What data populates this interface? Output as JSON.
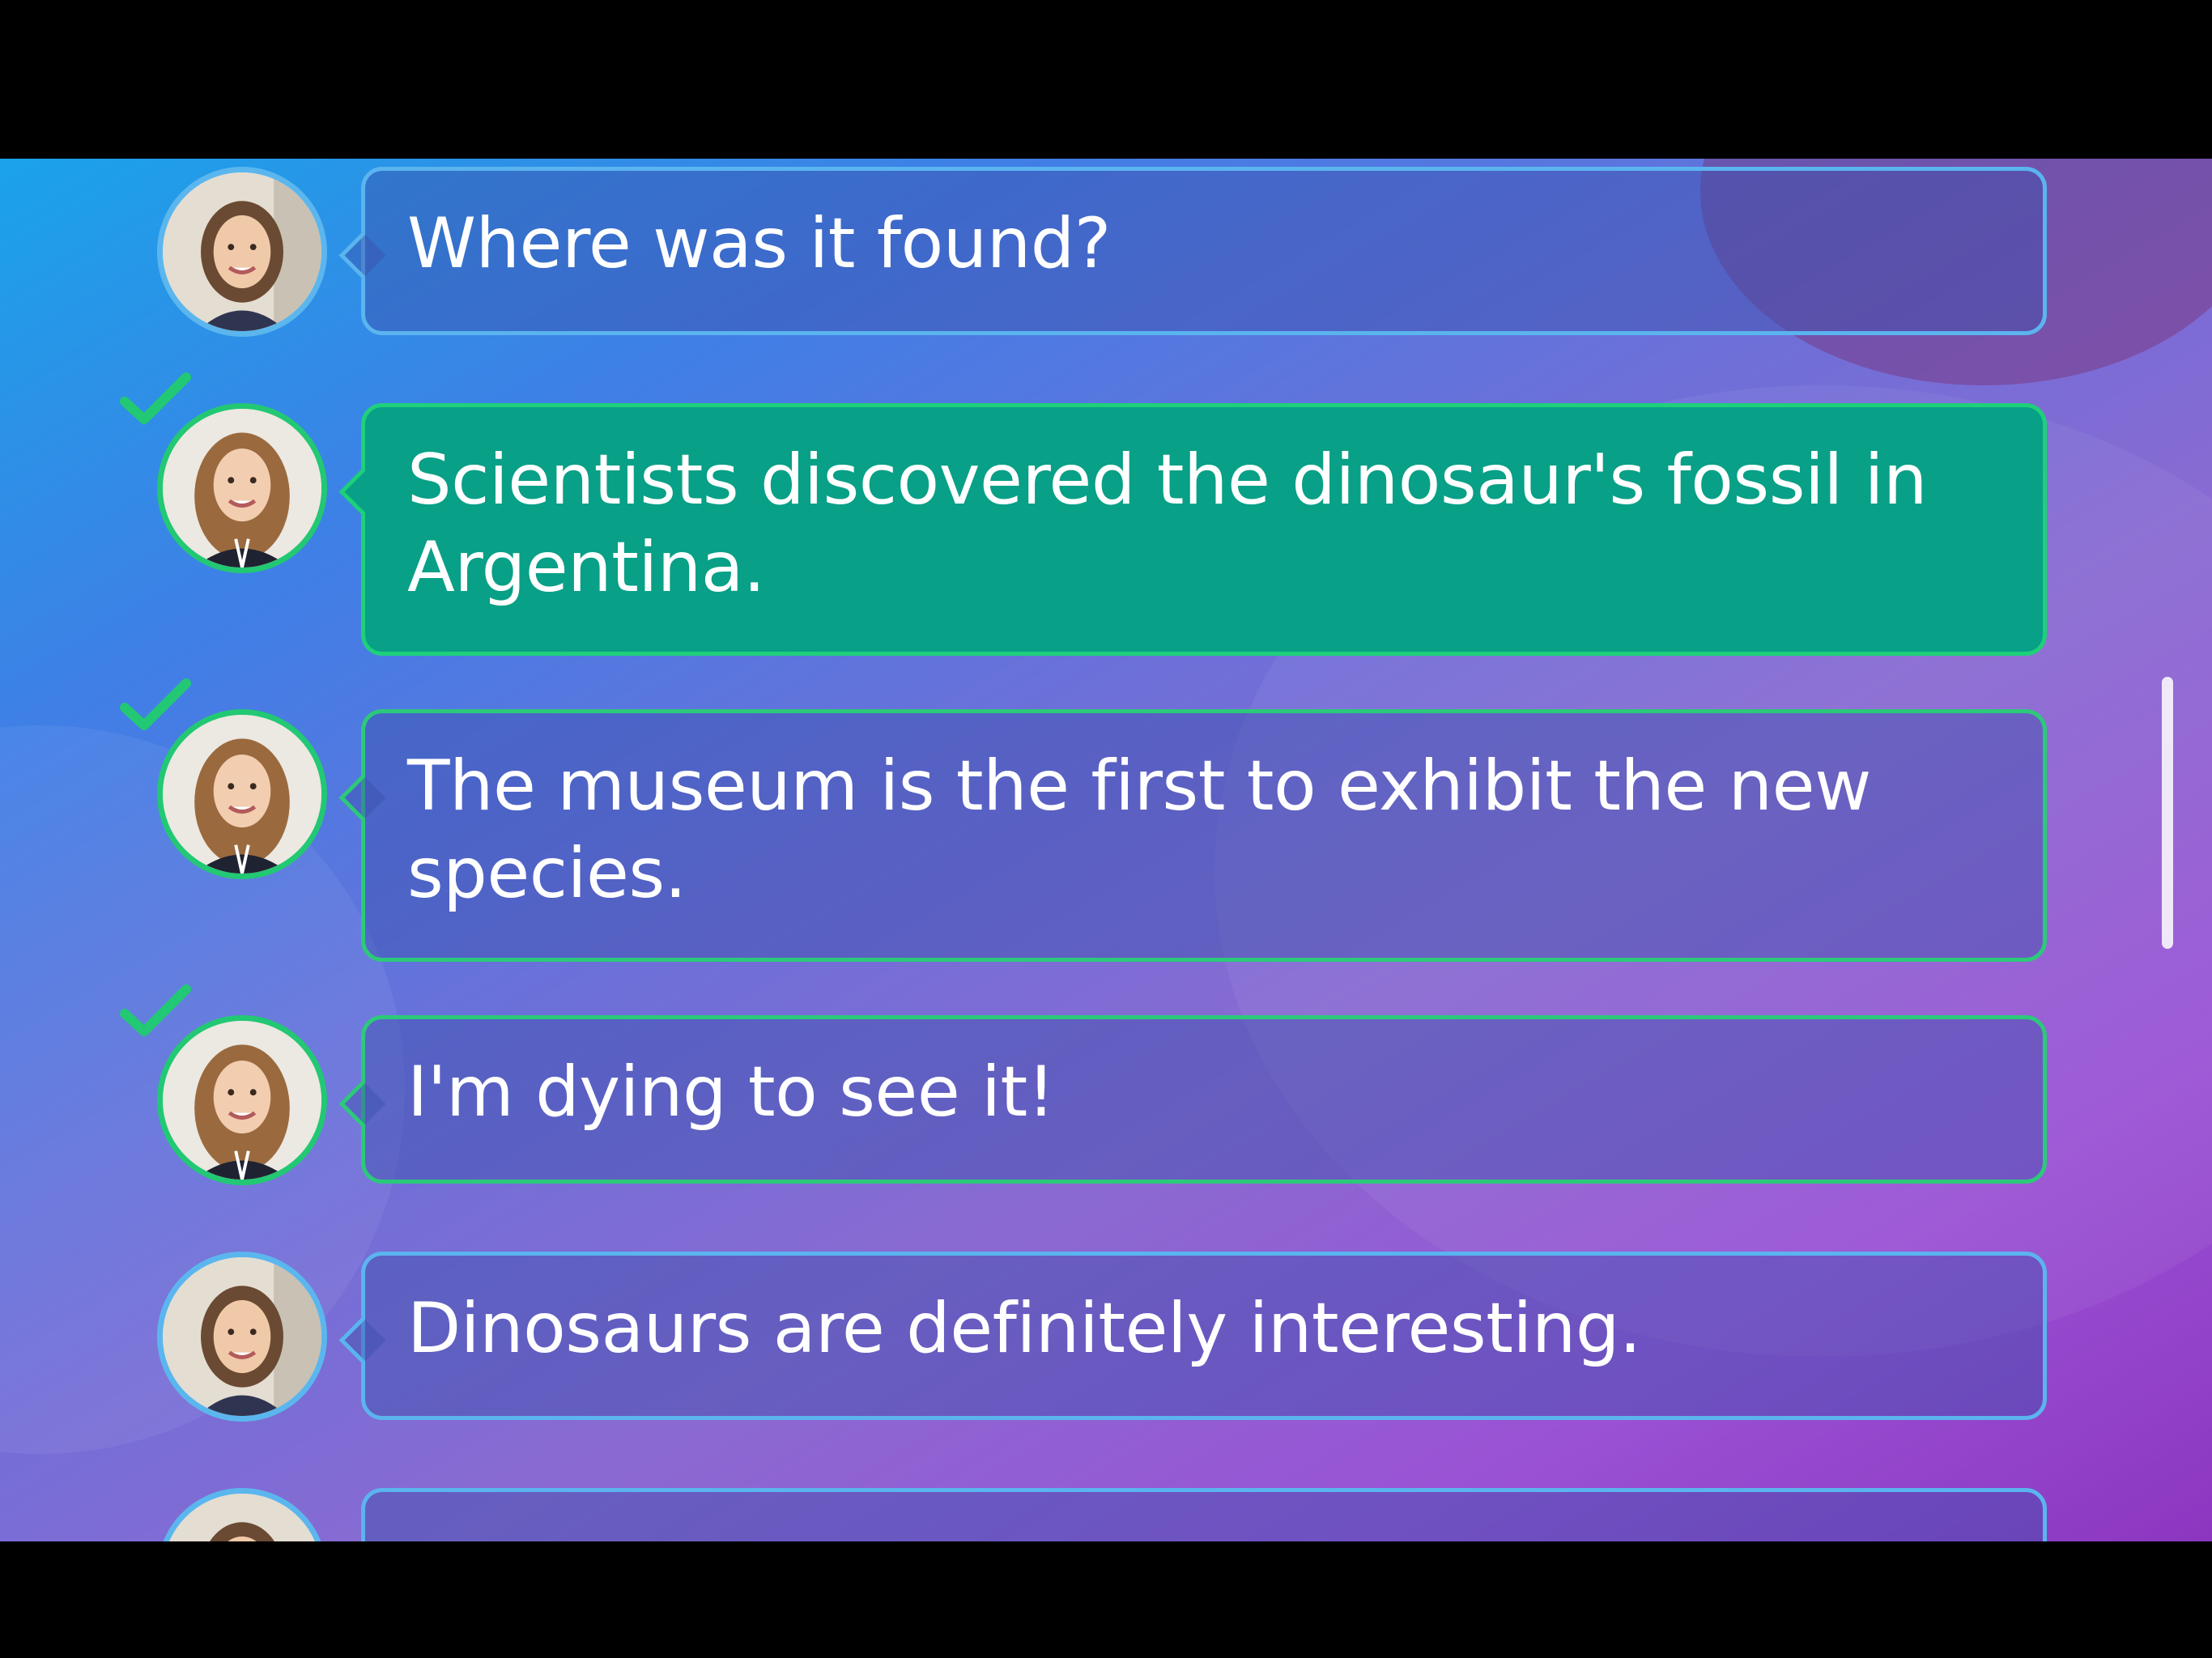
{
  "messages": [
    {
      "text": "Where was it found?",
      "speaker": "girl-1",
      "state": "default",
      "checked": false
    },
    {
      "text": "Scientists discovered the dinosaur's fossil in Argentina.",
      "speaker": "girl-2",
      "state": "active",
      "checked": true
    },
    {
      "text": "The museum is the first to exhibit the new species.",
      "speaker": "girl-2",
      "state": "correct",
      "checked": true
    },
    {
      "text": "I'm dying to see it!",
      "speaker": "girl-2",
      "state": "correct",
      "checked": true
    },
    {
      "text": "Dinosaurs are definitely interesting.",
      "speaker": "girl-1",
      "state": "default",
      "checked": false
    }
  ],
  "colors": {
    "check": "#22c873",
    "active_bubble": "#08a086",
    "bubble_border": "#5bb4ee",
    "correct_border": "#2cc97a"
  },
  "icons": {
    "check": "checkmark-icon"
  }
}
